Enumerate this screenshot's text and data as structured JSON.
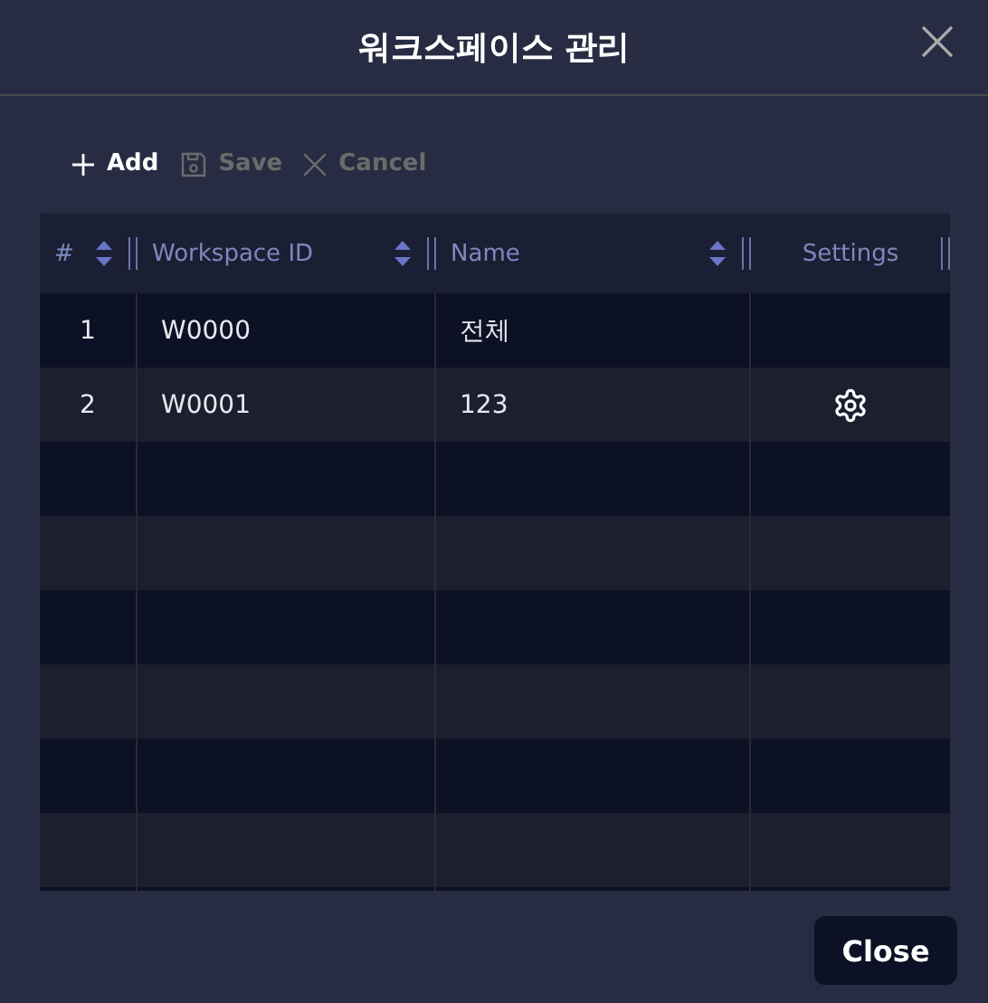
{
  "dialog": {
    "title": "워크스페이스 관리"
  },
  "toolbar": [
    {
      "label": "Add",
      "kind": "add",
      "disabled": false
    },
    {
      "label": "Save",
      "kind": "save",
      "disabled": true
    },
    {
      "label": "Cancel",
      "kind": "cancel",
      "disabled": true
    }
  ],
  "table": {
    "columns": [
      {
        "label": "#",
        "sortable": true
      },
      {
        "label": "Workspace ID",
        "sortable": true
      },
      {
        "label": "Name",
        "sortable": true
      },
      {
        "label": "Settings",
        "sortable": false
      }
    ],
    "rows": [
      {
        "index": "1",
        "workspace_id": "W0000",
        "name": "전체",
        "has_settings": false
      },
      {
        "index": "2",
        "workspace_id": "W0001",
        "name": "123",
        "has_settings": true
      }
    ]
  },
  "buttons": [
    {
      "label": "Close"
    }
  ]
}
